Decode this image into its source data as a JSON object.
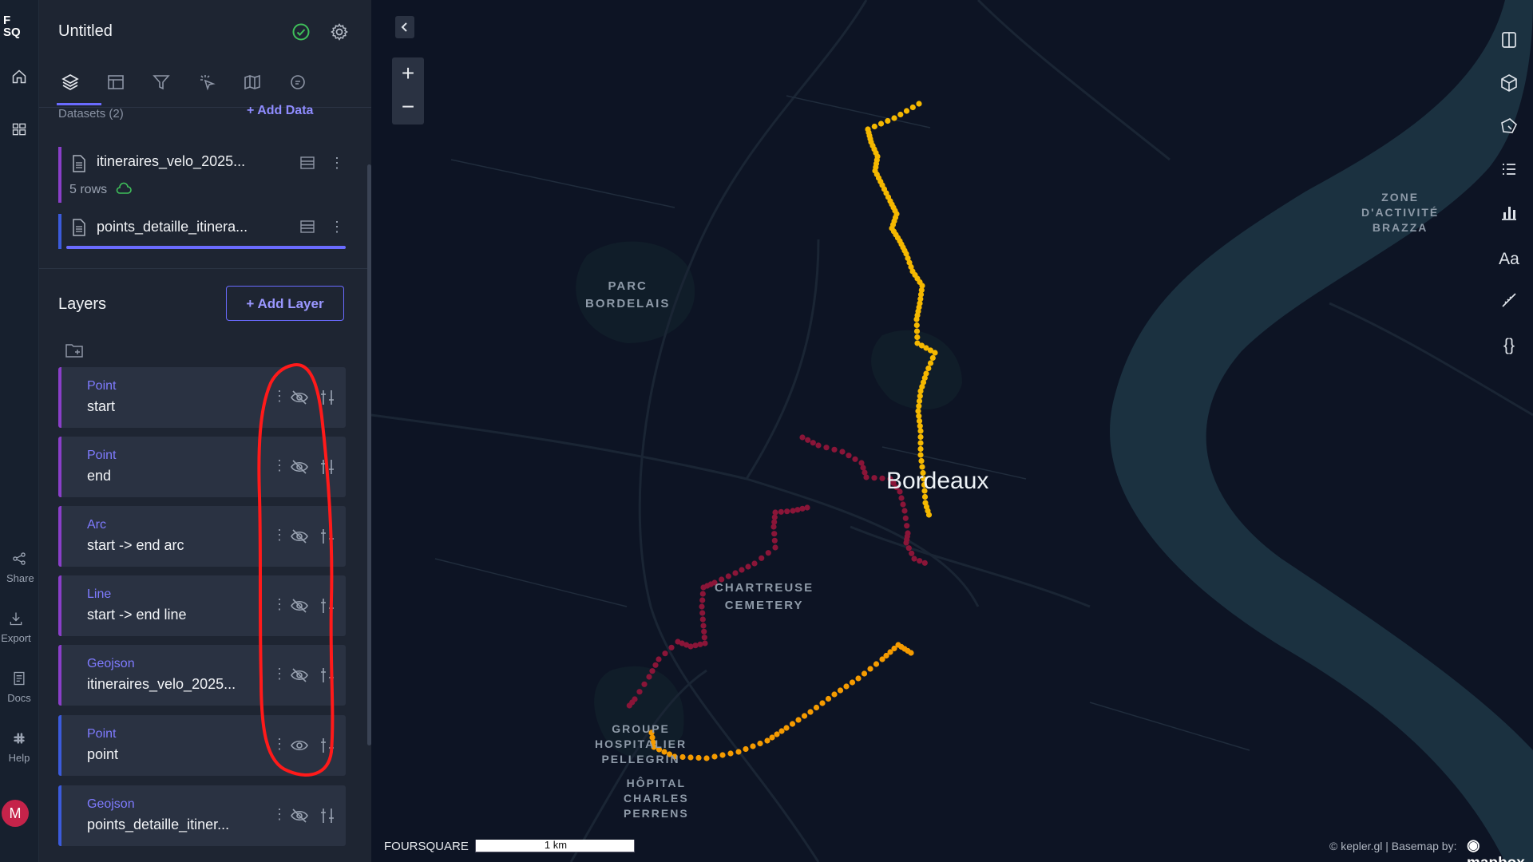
{
  "app": {
    "logo": "F\nSQ",
    "title": "Untitled"
  },
  "rail": {
    "share": "Share",
    "export": "Export",
    "docs": "Docs",
    "help": "Help",
    "avatar": "M"
  },
  "tabs": [
    "layers-icon",
    "table-icon",
    "filter-icon",
    "interaction-icon",
    "basemap-icon",
    "search-icon"
  ],
  "datasets": {
    "heading": "Datasets (2)",
    "add_label": "Add Data",
    "items": [
      {
        "name": "itineraires_velo_2025...",
        "rows": "5 rows",
        "color": "#8a3fc9"
      },
      {
        "name": "points_detaille_itinera...",
        "color": "#3b5bdb"
      }
    ]
  },
  "layers": {
    "heading": "Layers",
    "add_label": "Add Layer",
    "items": [
      {
        "type": "Point",
        "name": "start",
        "visible": false,
        "color": "#8a3fc9"
      },
      {
        "type": "Point",
        "name": "end",
        "visible": false,
        "color": "#8a3fc9"
      },
      {
        "type": "Arc",
        "name": "start -> end arc",
        "visible": false,
        "color": "#8a3fc9"
      },
      {
        "type": "Line",
        "name": "start -> end line",
        "visible": false,
        "color": "#8a3fc9"
      },
      {
        "type": "Geojson",
        "name": "itineraires_velo_2025...",
        "visible": false,
        "color": "#8a3fc9"
      },
      {
        "type": "Point",
        "name": "point",
        "visible": true,
        "color": "#3b5bdb"
      },
      {
        "type": "Geojson",
        "name": "points_detaille_itiner...",
        "visible": false,
        "color": "#3b5bdb"
      }
    ]
  },
  "map": {
    "city": "Bordeaux",
    "labels": {
      "parc": "PARC\nBORDELAIS",
      "chartreuse": "CHARTREUSE\nCEMETERY",
      "groupe": "GROUPE\nHOSPITALIER\nPELLEGRIN",
      "hopital": "HÔPITAL\nCHARLES\nPERRENS",
      "zone": "ZONE\nD'ACTIVITÉ\nBRAZZA"
    },
    "zoom_in": "+",
    "zoom_out": "−",
    "scale_brand": "FOURSQUARE",
    "scale": "1 km",
    "attribution": "© kepler.gl | Basemap by:",
    "basemap_brand": "mapbox",
    "route_colors": {
      "north": "#f5b800",
      "south": "#f59b00",
      "red": "#8a1538"
    },
    "right_toolbar": [
      "split-map-icon",
      "3d-cube-icon",
      "draw-polygon-icon",
      "legend-icon",
      "chart-icon",
      "text-icon",
      "measure-icon",
      "code-braces-icon"
    ],
    "right_text": {
      "font": "Aa",
      "code": "{}"
    }
  },
  "colors": {
    "accent": "#6a6bff",
    "annotation": "#ff1a1a"
  }
}
